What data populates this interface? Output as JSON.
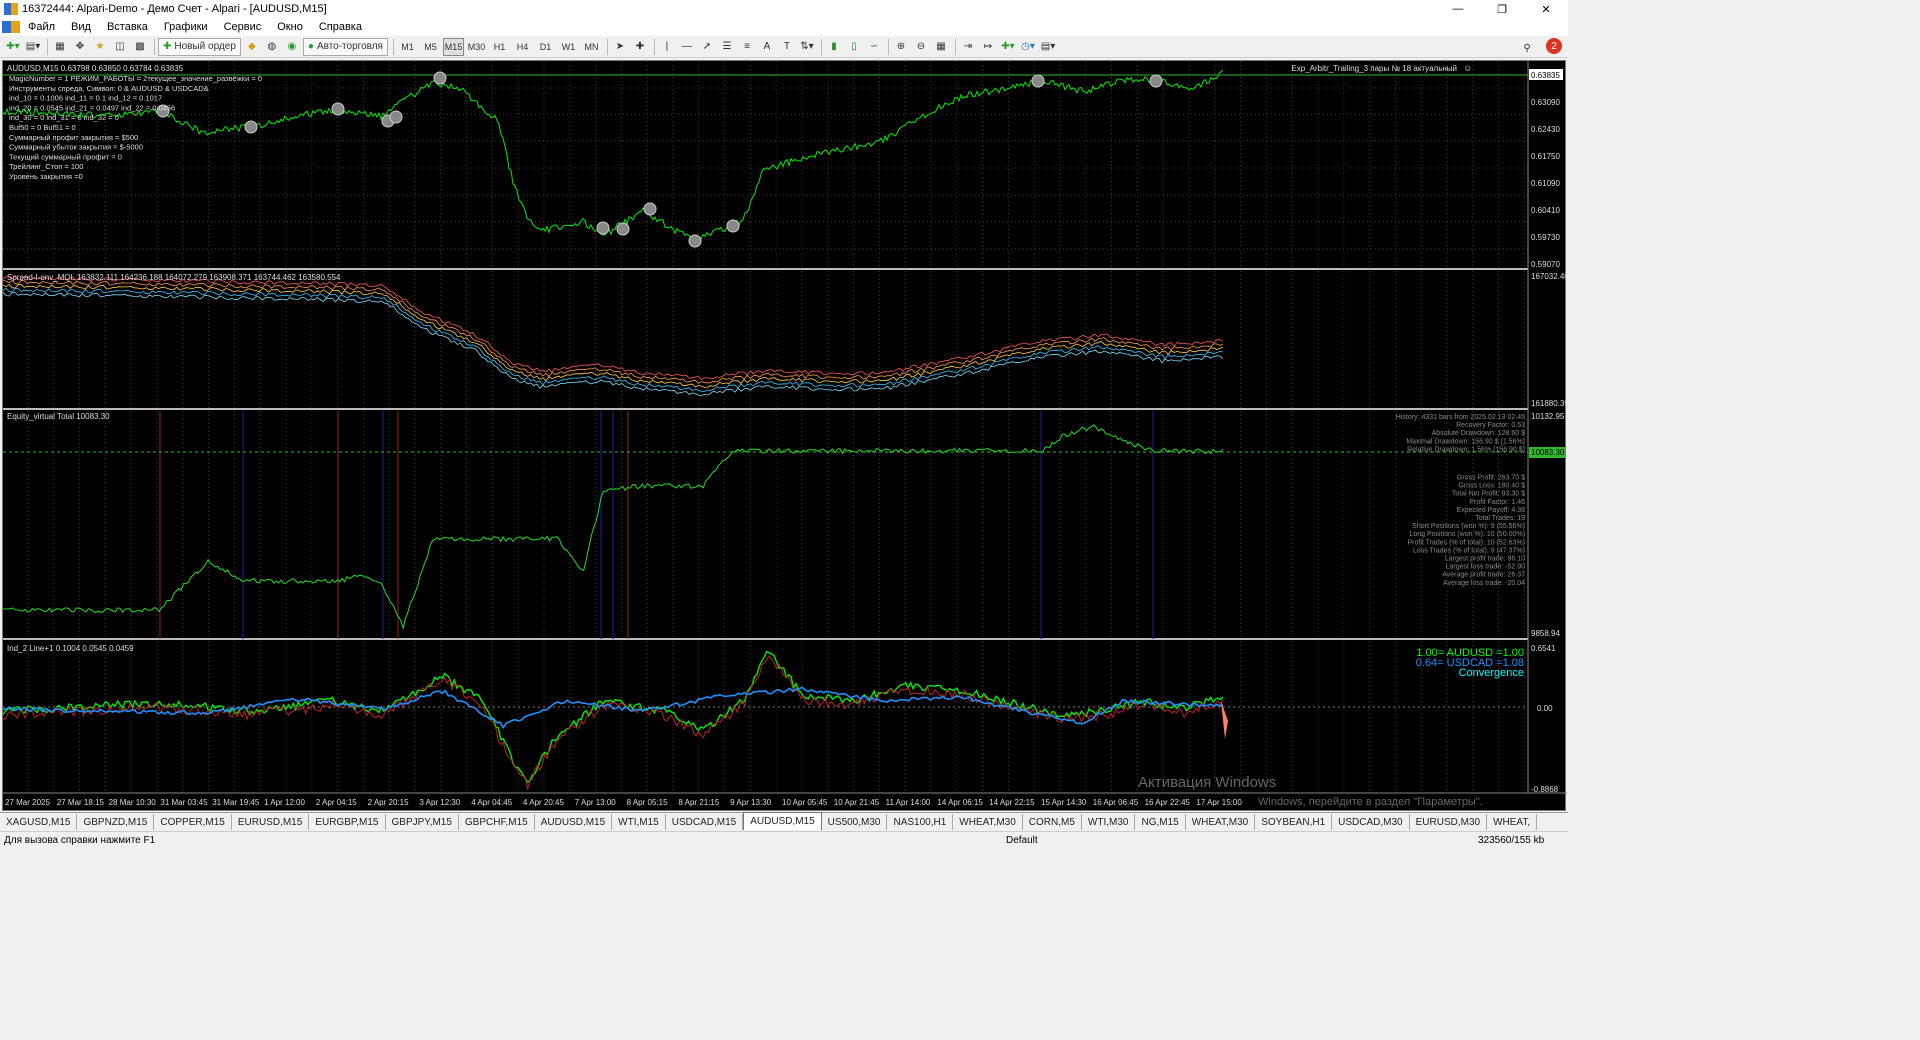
{
  "window": {
    "title": "16372444: Alpari-Demo - Демо Счет - Alpari - [AUDUSD,M15]"
  },
  "menu": [
    "Файл",
    "Вид",
    "Вставка",
    "Графики",
    "Сервис",
    "Окно",
    "Справка"
  ],
  "toolbar": {
    "new_order": "Новый ордер",
    "autotrading": "Авто-торговля",
    "timeframes": [
      "M1",
      "M5",
      "M15",
      "M30",
      "H1",
      "H4",
      "D1",
      "W1",
      "MN"
    ],
    "active_timeframe": "M15",
    "notification_count": "2"
  },
  "chart": {
    "main": {
      "ohlc": "AUDUSD,M15  0.63798 0.63850 0.63784 0.63835",
      "info_lines": [
        "MagicNumber = 1 РЕЖИМ_РАБОТЫ = 2текущее_значение_развёжки = 0",
        "Инструменты спреда, Символ: 0 & AUDUSD & USDCAD&",
        "ind_10 = 0.1006 ind_11 = 0.1 ind_12 = 0.1017",
        "ind_20 = 0.0545 ind_21 = 0.0497 ind_22 = 0.0456",
        "ind_30 = 0 ind_31 = 0 ind_32 = 0",
        "Buf50 = 0 Buf51 = 0",
        "Суммарный профит закрытия = $500",
        "Суммарный убыток закрытия = $-5000",
        "Текущий суммарный профит = 0",
        "Трейлинг_Стоп = 100",
        "Уровень закрытия =0"
      ],
      "expert": "Exp_Arbitr_Trailing_3 пары № 18 актуальный",
      "price_labels": [
        "0.63835",
        "0.63090",
        "0.62430",
        "0.61750",
        "0.61090",
        "0.60410",
        "0.59730",
        "0.59070"
      ],
      "current_price": "0.63835"
    },
    "spread": {
      "label": "Spread-I-env_MQL 163832.111 164236.188 164072.279 163908.371 163744.462 163580.554",
      "scale_top": "167032.40",
      "scale_bottom": "161880.39"
    },
    "equity": {
      "label": "Equity_virtual Total 10083.30",
      "scale_top": "10132.95",
      "scale_current": "10083.30",
      "scale_bottom": "9858.94",
      "report": [
        "History: 4331 bars from 2025.02.13 02:45",
        "Recovery Factor: 0.53",
        "Absolute Drawdown: 128.60 $",
        "Maximal Drawdown: 156.90 $ (1.56%)",
        "Relative Drawdown: 1.56% (156.90 $)",
        "Gross Profit: 263.70 $",
        "Gross Loss: 180.40 $",
        "Total Net Profit: 83.30 $",
        "Profit Factor: 1.46",
        "Expected Payoff: 4.38",
        "Total Trades: 19",
        "Short Positions (won %): 9 (55.56%)",
        "Long Positions (won %): 10 (50.00%)",
        "Profit Trades (% of total): 10 (52.63%)",
        "Loss Trades (% of total): 9 (47.37%)",
        "Largest profit trade: 96.10",
        "Largest loss trade: -52.90",
        "Average profit trade: 26.37",
        "Average loss trade: -20.04"
      ]
    },
    "ind2": {
      "label": "Ind_2 Line+1 0.1004 0.0545 0.0459",
      "legend": [
        {
          "text": "1.00= AUDUSD =1.00",
          "color": "#00ff00"
        },
        {
          "text": "0.64= USDCAD =1.08",
          "color": "#1e90ff"
        },
        {
          "text": "Convergence",
          "color": "#00ffff"
        }
      ],
      "scale_top": "0.6541",
      "scale_mid": "0.00",
      "scale_bottom": "-0.8868"
    },
    "time_labels": [
      "27 Mar 2025",
      "27 Mar 18:15",
      "28 Mar 10:30",
      "31 Mar 03:45",
      "31 Mar 19:45",
      "1 Apr 12:00",
      "2 Apr 04:15",
      "2 Apr 20:15",
      "3 Apr 12:30",
      "4 Apr 04:45",
      "4 Apr 20:45",
      "7 Apr 13:00",
      "8 Apr 05:15",
      "8 Apr 21:15",
      "9 Apr 13:30",
      "10 Apr 05:45",
      "10 Apr 21:45",
      "11 Apr 14:00",
      "14 Apr 06:15",
      "14 Apr 22:15",
      "15 Apr 14:30",
      "16 Apr 06:45",
      "16 Apr 22:45",
      "17 Apr 15:00"
    ],
    "watermark": {
      "title": "Активация Windows",
      "sub": "Windows, перейдите в раздел \"Параметры\"."
    }
  },
  "tabs": [
    "XAGUSD,M15",
    "GBPNZD,M15",
    "COPPER,M15",
    "EURUSD,M15",
    "EURGBP,M15",
    "GBPJPY,M15",
    "GBPCHF,M15",
    "AUDUSD,M15",
    "WTI,M15",
    "USDCAD,M15",
    "AUDUSD,M15",
    "US500,M30",
    "NAS100,H1",
    "WHEAT,M30",
    "CORN,M5",
    "WTI,M30",
    "NG,M15",
    "WHEAT,M30",
    "SOYBEAN,H1",
    "USDCAD,M30",
    "EURUSD,M30",
    "WHEAT,"
  ],
  "active_tab": 10,
  "status": {
    "help": "Для вызова справки нажмите F1",
    "profile": "Default",
    "traffic": "323560/155 kb"
  }
}
